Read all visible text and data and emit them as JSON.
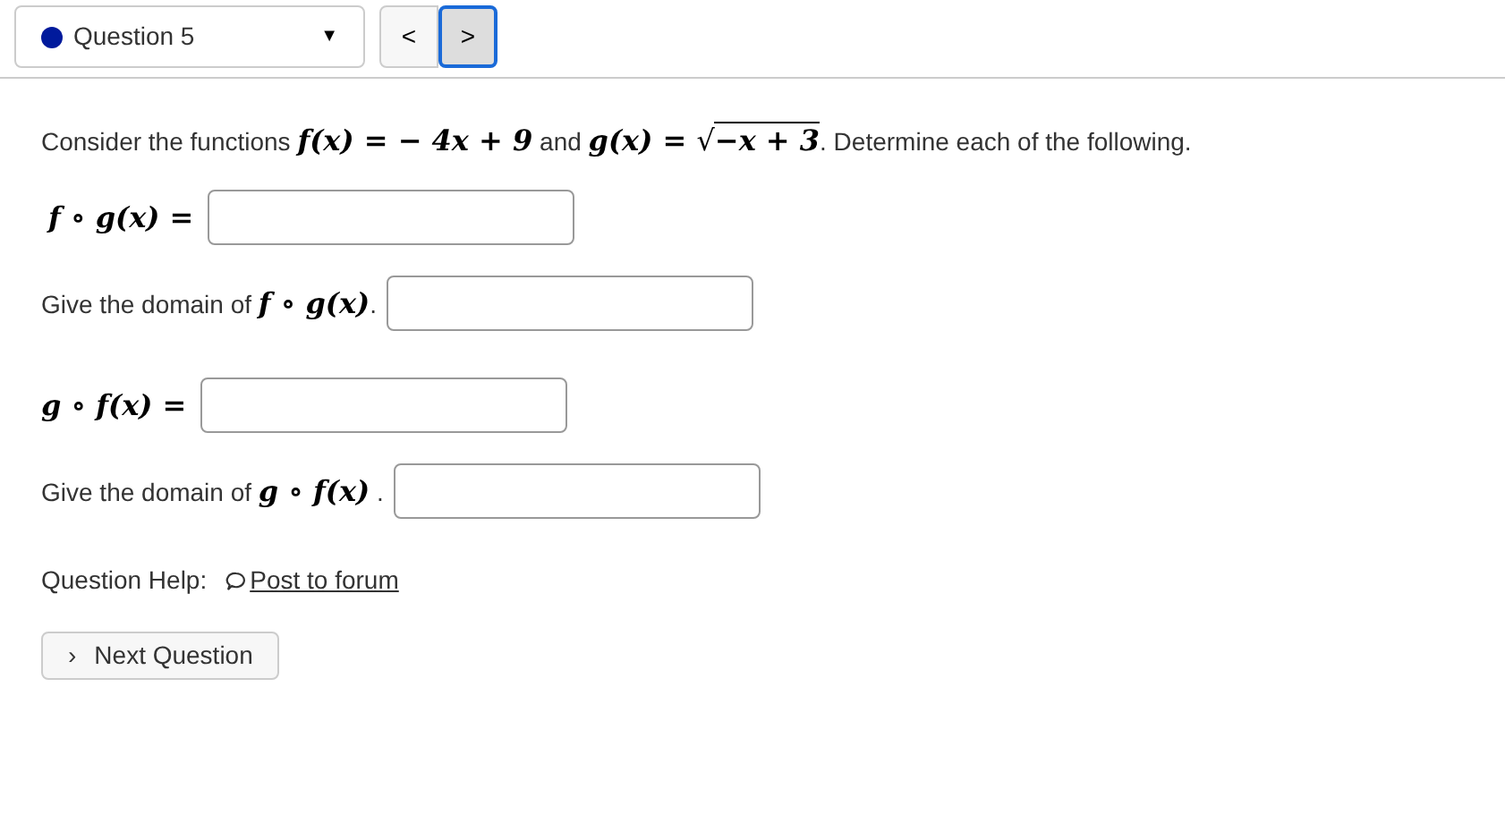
{
  "question_select": {
    "label": "Question 5",
    "color": "#001a9c",
    "caret": "▼"
  },
  "nav_buttons": [
    {
      "label": "<",
      "focused": false
    },
    {
      "label": ">",
      "focused": true
    }
  ],
  "intro": [
    {
      "kind": "text",
      "text": "Consider the functions "
    },
    {
      "kind": "math",
      "text": "f(x) = − 4x + 9"
    },
    {
      "kind": "text",
      "text": " and "
    },
    {
      "kind": "math",
      "text": "g(x) = "
    },
    {
      "kind": "sqrt",
      "radical": "√",
      "text": "−x + 3"
    },
    {
      "kind": "text",
      "text": ". Determine each of the following."
    }
  ],
  "questions": [
    {
      "kind": "equation",
      "math": "f ∘ g(x) ="
    },
    {
      "kind": "domain",
      "text": "Give the domain of ",
      "math": "f ∘ g(x)",
      "end": "."
    },
    {
      "kind": "equation",
      "math": "g ∘ f(x) ="
    },
    {
      "kind": "domain",
      "text": "Give the domain of ",
      "math": "g ∘ f(x)",
      "end": " ."
    }
  ],
  "help": {
    "label": "Question Help:",
    "link": "Post to forum"
  },
  "next_button": {
    "chevron": "›",
    "label": "Next Question"
  }
}
